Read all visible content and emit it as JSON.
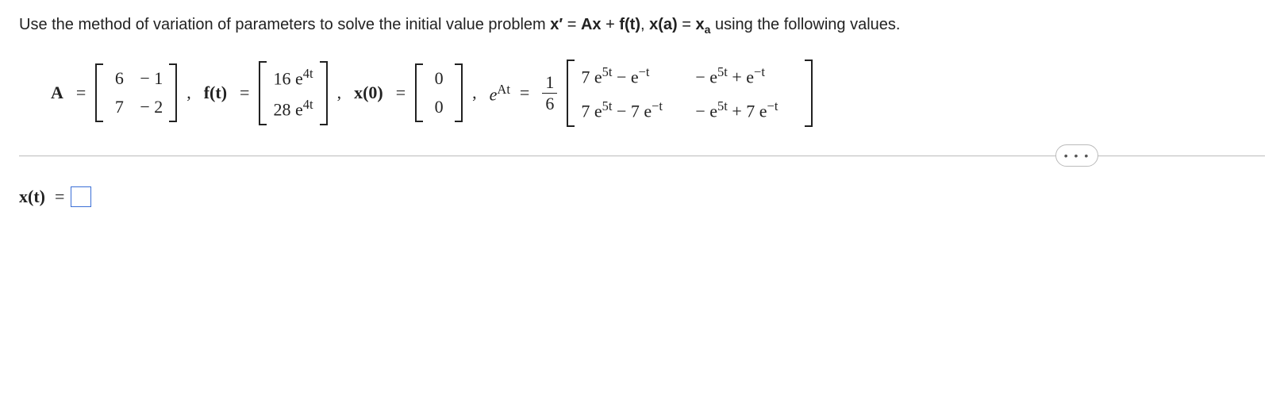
{
  "problem": {
    "text_before": "Use the method of variation of parameters to solve the initial value problem ",
    "eq1_lhs": "x′",
    "eq1_eq": " = ",
    "eq1_rhs_a": "Ax",
    "eq1_plus": " + ",
    "eq1_rhs_b": "f(t)",
    "eq1_comma": ", ",
    "eq2_lhs": "x(a)",
    "eq2_eq": " = ",
    "eq2_rhs": "x",
    "eq2_sub": "a",
    "text_after": " using the following values."
  },
  "labels": {
    "A": "A",
    "ft": "f(t)",
    "x0": "x(0)",
    "eAt_e": "e",
    "eAt_At": "At",
    "eq": "=",
    "comma": ",",
    "answer_lhs": "x(t)",
    "more": "• • •"
  },
  "matrices": {
    "A": [
      [
        "6",
        "− 1"
      ],
      [
        "7",
        "− 2"
      ]
    ],
    "ft": [
      [
        "16 e",
        "4t"
      ],
      [
        "28 e",
        "4t"
      ]
    ],
    "x0": [
      [
        "0"
      ],
      [
        "0"
      ]
    ],
    "frac": {
      "num": "1",
      "den": "6"
    },
    "eAt": [
      [
        "7 e",
        "5t",
        " − e",
        "−t",
        "− e",
        "5t",
        " + e",
        "−t"
      ],
      [
        "7 e",
        "5t",
        " − 7 e",
        "−t",
        "− e",
        "5t",
        " + 7 e",
        "−t"
      ]
    ]
  }
}
